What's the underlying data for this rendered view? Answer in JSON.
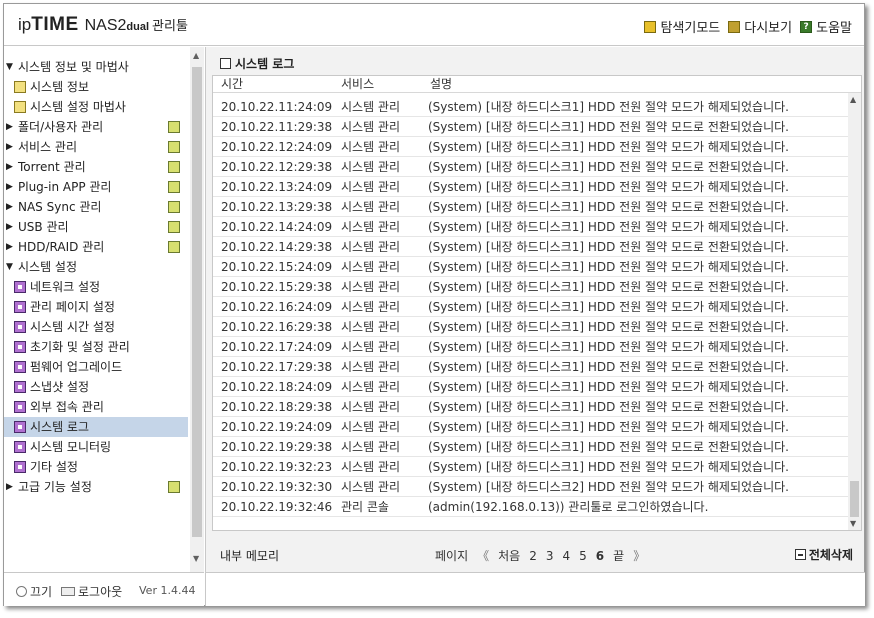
{
  "header": {
    "brand_ip": "ip",
    "brand_time": "TIME",
    "brand_nas": "NAS2",
    "brand_dual": "dual",
    "brand_mgr": "관리툴",
    "menu": [
      {
        "label": "탐색기모드",
        "icon": "explorer-icon"
      },
      {
        "label": "다시보기",
        "icon": "reload-icon"
      },
      {
        "label": "도움말",
        "icon": "help-icon"
      }
    ]
  },
  "sidebar": {
    "items": [
      {
        "label": "시스템 정보 및 마법사",
        "level": 0,
        "expanded": true
      },
      {
        "label": "시스템 정보",
        "level": 1,
        "icon": "chart-icon"
      },
      {
        "label": "시스템 설정 마법사",
        "level": 1,
        "icon": "chart-icon"
      },
      {
        "label": "폴더/사용자 관리",
        "level": 0,
        "expanded": false,
        "right_icon": "folder-user-icon"
      },
      {
        "label": "서비스 관리",
        "level": 0,
        "expanded": false,
        "right_icon": "service-icon"
      },
      {
        "label": "Torrent 관리",
        "level": 0,
        "expanded": false,
        "right_icon": "torrent-icon"
      },
      {
        "label": "Plug-in APP 관리",
        "level": 0,
        "expanded": false,
        "right_icon": "plugin-icon"
      },
      {
        "label": "NAS Sync 관리",
        "level": 0,
        "expanded": false,
        "right_icon": "sync-icon"
      },
      {
        "label": "USB 관리",
        "level": 0,
        "expanded": false,
        "right_icon": "usb-icon"
      },
      {
        "label": "HDD/RAID 관리",
        "level": 0,
        "expanded": false,
        "right_icon": "hdd-icon"
      },
      {
        "label": "시스템 설정",
        "level": 0,
        "expanded": true
      },
      {
        "label": "네트워크 설정",
        "level": 1,
        "icon": "settings-icon"
      },
      {
        "label": "관리 페이지 설정",
        "level": 1,
        "icon": "settings-icon"
      },
      {
        "label": "시스템 시간 설정",
        "level": 1,
        "icon": "settings-icon"
      },
      {
        "label": "초기화 및 설정 관리",
        "level": 1,
        "icon": "settings-icon"
      },
      {
        "label": "펌웨어 업그레이드",
        "level": 1,
        "icon": "settings-icon"
      },
      {
        "label": "스냅샷 설정",
        "level": 1,
        "icon": "settings-icon"
      },
      {
        "label": "외부 접속 관리",
        "level": 1,
        "icon": "settings-icon"
      },
      {
        "label": "시스템 로그",
        "level": 1,
        "icon": "settings-icon",
        "selected": true
      },
      {
        "label": "시스템 모니터링",
        "level": 1,
        "icon": "settings-icon"
      },
      {
        "label": "기타 설정",
        "level": 1,
        "icon": "settings-icon"
      },
      {
        "label": "고급 기능 설정",
        "level": 0,
        "expanded": false,
        "right_icon": "advanced-icon"
      }
    ]
  },
  "footer": {
    "power_label": "끄기",
    "logout_label": "로그아웃",
    "version": "Ver 1.4.44"
  },
  "log": {
    "title": "시스템 로그",
    "columns": {
      "time": "시간",
      "service": "서비스",
      "desc": "설명"
    },
    "rows": [
      {
        "time": "20.10.22.11:24:09",
        "service": "시스템 관리",
        "desc": "(System) [내장 하드디스크1] HDD 전원 절약 모드가 해제되었습니다."
      },
      {
        "time": "20.10.22.11:29:38",
        "service": "시스템 관리",
        "desc": "(System) [내장 하드디스크1] HDD 전원 절약 모드로 전환되었습니다."
      },
      {
        "time": "20.10.22.12:24:09",
        "service": "시스템 관리",
        "desc": "(System) [내장 하드디스크1] HDD 전원 절약 모드가 해제되었습니다."
      },
      {
        "time": "20.10.22.12:29:38",
        "service": "시스템 관리",
        "desc": "(System) [내장 하드디스크1] HDD 전원 절약 모드로 전환되었습니다."
      },
      {
        "time": "20.10.22.13:24:09",
        "service": "시스템 관리",
        "desc": "(System) [내장 하드디스크1] HDD 전원 절약 모드가 해제되었습니다."
      },
      {
        "time": "20.10.22.13:29:38",
        "service": "시스템 관리",
        "desc": "(System) [내장 하드디스크1] HDD 전원 절약 모드로 전환되었습니다."
      },
      {
        "time": "20.10.22.14:24:09",
        "service": "시스템 관리",
        "desc": "(System) [내장 하드디스크1] HDD 전원 절약 모드가 해제되었습니다."
      },
      {
        "time": "20.10.22.14:29:38",
        "service": "시스템 관리",
        "desc": "(System) [내장 하드디스크1] HDD 전원 절약 모드로 전환되었습니다."
      },
      {
        "time": "20.10.22.15:24:09",
        "service": "시스템 관리",
        "desc": "(System) [내장 하드디스크1] HDD 전원 절약 모드가 해제되었습니다."
      },
      {
        "time": "20.10.22.15:29:38",
        "service": "시스템 관리",
        "desc": "(System) [내장 하드디스크1] HDD 전원 절약 모드로 전환되었습니다."
      },
      {
        "time": "20.10.22.16:24:09",
        "service": "시스템 관리",
        "desc": "(System) [내장 하드디스크1] HDD 전원 절약 모드가 해제되었습니다."
      },
      {
        "time": "20.10.22.16:29:38",
        "service": "시스템 관리",
        "desc": "(System) [내장 하드디스크1] HDD 전원 절약 모드로 전환되었습니다."
      },
      {
        "time": "20.10.22.17:24:09",
        "service": "시스템 관리",
        "desc": "(System) [내장 하드디스크1] HDD 전원 절약 모드가 해제되었습니다."
      },
      {
        "time": "20.10.22.17:29:38",
        "service": "시스템 관리",
        "desc": "(System) [내장 하드디스크1] HDD 전원 절약 모드로 전환되었습니다."
      },
      {
        "time": "20.10.22.18:24:09",
        "service": "시스템 관리",
        "desc": "(System) [내장 하드디스크1] HDD 전원 절약 모드가 해제되었습니다."
      },
      {
        "time": "20.10.22.18:29:38",
        "service": "시스템 관리",
        "desc": "(System) [내장 하드디스크1] HDD 전원 절약 모드로 전환되었습니다."
      },
      {
        "time": "20.10.22.19:24:09",
        "service": "시스템 관리",
        "desc": "(System) [내장 하드디스크1] HDD 전원 절약 모드가 해제되었습니다."
      },
      {
        "time": "20.10.22.19:29:38",
        "service": "시스템 관리",
        "desc": "(System) [내장 하드디스크1] HDD 전원 절약 모드로 전환되었습니다."
      },
      {
        "time": "20.10.22.19:32:23",
        "service": "시스템 관리",
        "desc": "(System) [내장 하드디스크1] HDD 전원 절약 모드가 해제되었습니다."
      },
      {
        "time": "20.10.22.19:32:30",
        "service": "시스템 관리",
        "desc": "(System) [내장 하드디스크2] HDD 전원 절약 모드가 해제되었습니다."
      },
      {
        "time": "20.10.22.19:32:46",
        "service": "관리 콘솔",
        "desc": "(admin(192.168.0.13)) 관리툴로 로그인하였습니다."
      }
    ]
  },
  "bottom": {
    "memo_label": "내부 메모리",
    "page_label": "페이지",
    "prev_label": "《",
    "first_label": "처음",
    "pages": [
      "2",
      "3",
      "4",
      "5",
      "6"
    ],
    "current_page": "6",
    "last_label": "끝",
    "next_label": "》",
    "delete_all_label": "전체삭제"
  }
}
